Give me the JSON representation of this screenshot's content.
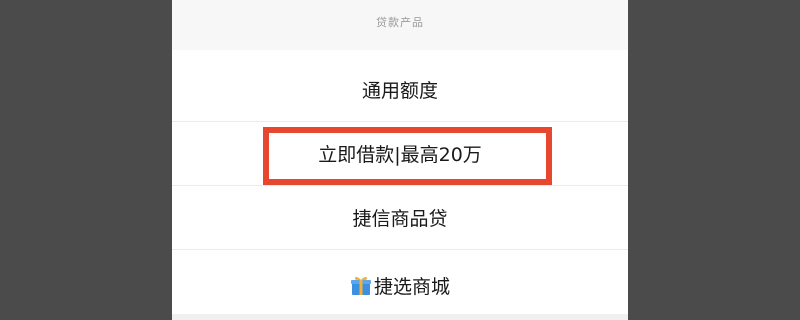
{
  "sheet": {
    "title": "贷款产品",
    "items": [
      {
        "label": "通用额度"
      },
      {
        "label": "立即借款|最高20万"
      },
      {
        "label": "捷信商品贷"
      },
      {
        "label": "捷选商城",
        "icon": "gift-icon"
      }
    ]
  },
  "colors": {
    "backdrop": "#4b4b4b",
    "highlight_border": "#e8472f",
    "gift_box": "#3d8fe0",
    "gift_ribbon": "#f2b233"
  }
}
